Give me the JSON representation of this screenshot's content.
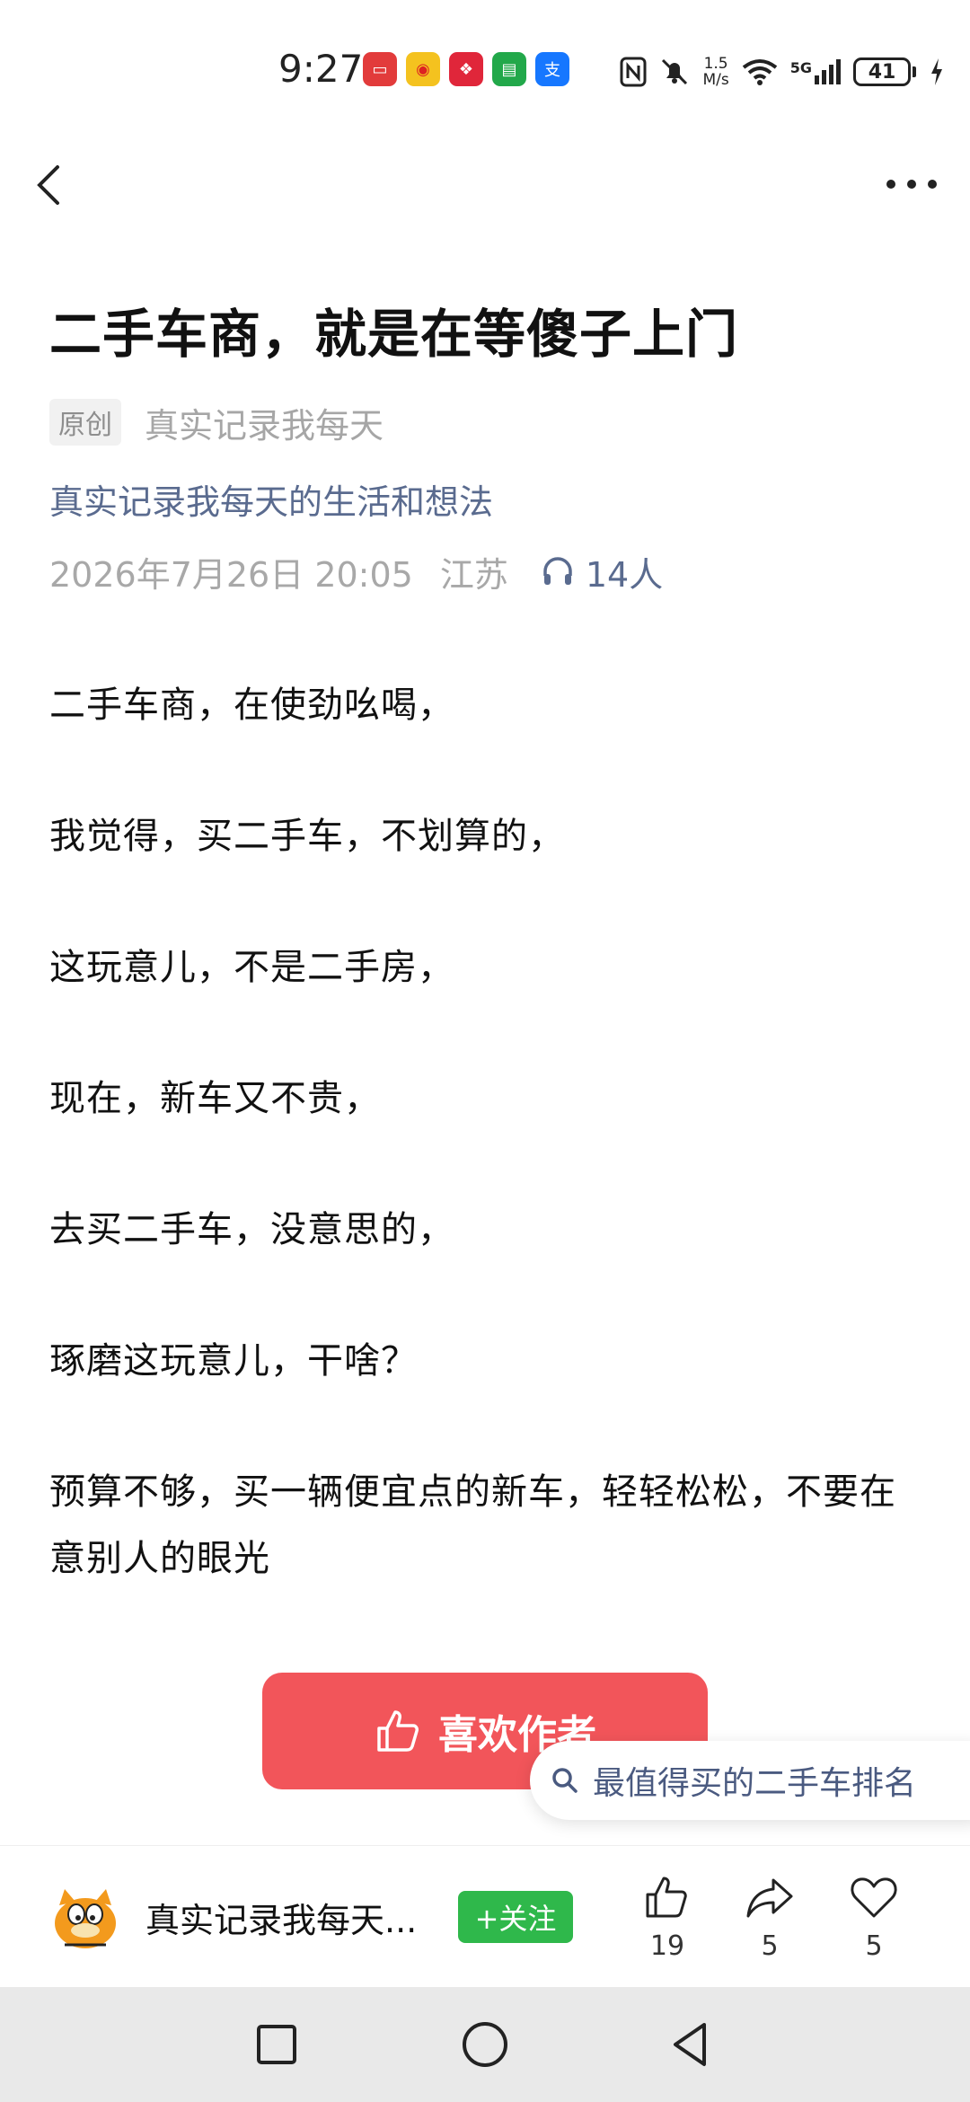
{
  "status_bar": {
    "time": "9:27",
    "network_speed_value": "1.5",
    "network_speed_unit": "M/s",
    "network_type": "5G",
    "battery": "41"
  },
  "header": {
    "back_icon": "chevron-left-icon",
    "more_icon": "more-dots-icon"
  },
  "article": {
    "title": "二手车商，就是在等傻子上门",
    "original_tag": "原创",
    "author": "真实记录我每天",
    "account_description": "真实记录我每天的生活和想法",
    "datetime": "2026年7月26日 20:05",
    "location": "江苏",
    "listeners": "14人",
    "paragraphs": [
      "二手车商，在使劲吆喝，",
      "我觉得，买二手车，不划算的，",
      "这玩意儿，不是二手房，",
      "现在，新车又不贵，",
      "去买二手车，没意思的，",
      "琢磨这玩意儿，干啥？",
      "预算不够，买一辆便宜点的新车，轻轻松松，不要在意别人的眼光"
    ]
  },
  "like_author": {
    "label": "喜欢作者"
  },
  "search_suggestion": {
    "text": "最值得买的二手车排名"
  },
  "author_bar": {
    "name": "真实记录我每天...",
    "follow_label": "+关注",
    "likes": "19",
    "shares": "5",
    "favorites": "5"
  },
  "colors": {
    "accent_red": "#f2555a",
    "follow_green": "#2fb84b",
    "link_blue": "#5a6b8f"
  }
}
